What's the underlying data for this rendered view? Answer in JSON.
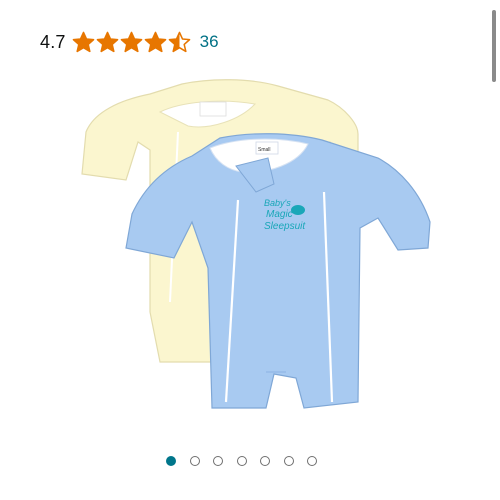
{
  "rating": {
    "value": "4.7",
    "stars": 4.7,
    "review_count": "36",
    "star_color": "#e77600"
  },
  "product": {
    "image_alt": "Two baby sleep suits, cream and light blue",
    "garment_label_top": "Baby's",
    "garment_label_mid": "Magic",
    "garment_label_bottom": "Sleepsuit",
    "size_tag": "Small",
    "colors": {
      "cream": "#fbf6cf",
      "blue": "#a8caf1",
      "accent": "#1aa7b8"
    }
  },
  "carousel": {
    "total": 7,
    "active_index": 0,
    "active_color": "#00768b"
  }
}
